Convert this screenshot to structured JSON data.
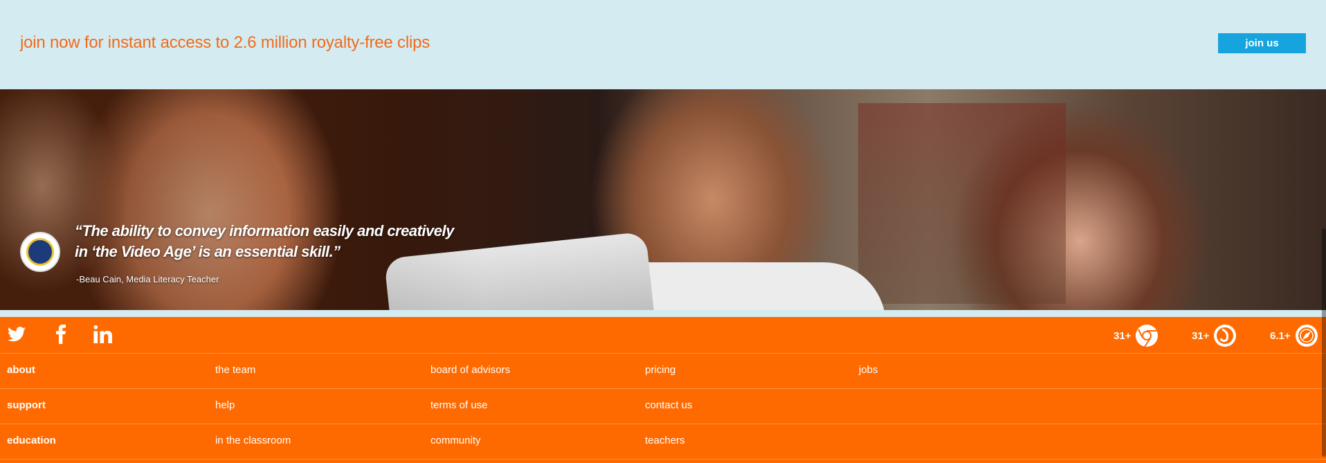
{
  "banner": {
    "join_text": "join now for instant access to 2.6 million royalty-free clips",
    "join_button": "join us"
  },
  "hero": {
    "quote": "“The ability to convey information easily and creatively in ‘the Video Age’ is an essential skill.”",
    "author": "-Beau Cain, Media Literacy Teacher",
    "badge_icon": "school-seal-icon"
  },
  "social": {
    "icons": [
      "twitter-icon",
      "facebook-icon",
      "linkedin-icon"
    ]
  },
  "browsers": [
    {
      "version": "31+",
      "icon": "chrome-icon"
    },
    {
      "version": "31+",
      "icon": "firefox-icon"
    },
    {
      "version": "6.1+",
      "icon": "safari-icon"
    }
  ],
  "nav": [
    {
      "links": [
        "about",
        "the team",
        "board of advisors",
        "pricing",
        "jobs"
      ]
    },
    {
      "links": [
        "support",
        "help",
        "terms of use",
        "contact us"
      ]
    },
    {
      "links": [
        "education",
        "in the classroom",
        "community",
        "teachers"
      ]
    }
  ],
  "colors": {
    "banner_bg": "#d4ecf1",
    "accent_orange": "#ff6a00",
    "join_text": "#f26a1b",
    "button_blue": "#16a4df"
  }
}
